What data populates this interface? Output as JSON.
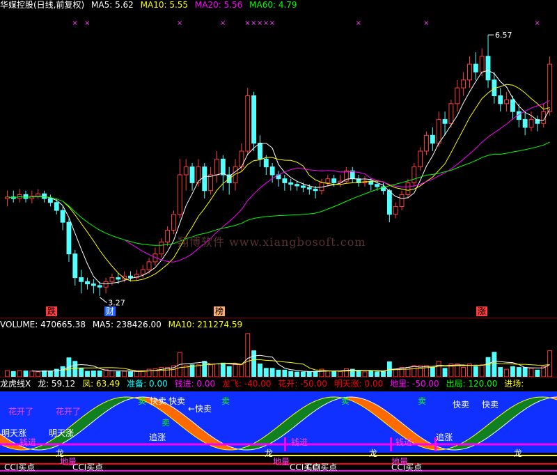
{
  "main_panel": {
    "title": "华媒控股(日线,前复权)",
    "indicators": [
      {
        "label": "MA5: 5.62",
        "color": "#ffffff"
      },
      {
        "label": "MA10: 5.55",
        "color": "#ffff00"
      },
      {
        "label": "MA20: 5.56",
        "color": "#ff00ff"
      },
      {
        "label": "MA60: 4.79",
        "color": "#00ff00"
      }
    ],
    "high_label": "6.57",
    "low_label": "3.27",
    "watermark": "翔博软件 www.xiangbosoft.com",
    "markers": [
      {
        "text": "跌",
        "bg": "#ff3c3c",
        "fg": "#000"
      },
      {
        "text": "财",
        "bg": "#2060ff",
        "fg": "#fff"
      },
      {
        "text": "榜",
        "bg": "#ffb070",
        "fg": "#000"
      },
      {
        "text": "涨",
        "bg": "#ff3c3c",
        "fg": "#000"
      }
    ]
  },
  "volume_panel": {
    "indicators": [
      {
        "label": "VOLUME: 470665.38",
        "color": "#ffffff"
      },
      {
        "label": "MA5: 238426.00",
        "color": "#ffffff"
      },
      {
        "label": "MA10: 211274.59",
        "color": "#ffff00"
      }
    ]
  },
  "signal_panel": {
    "indicators": [
      {
        "label": "龙虎线X",
        "color": "#ffffff"
      },
      {
        "label": "龙: 59.12",
        "color": "#ffffff"
      },
      {
        "label": "凤: 63.49",
        "color": "#ffff00"
      },
      {
        "label": "准备: 0.00",
        "color": "#00ffff"
      },
      {
        "label": "钱进: 0.00",
        "color": "#ff00ff"
      },
      {
        "label": "龙飞: -40.00",
        "color": "#ff0000"
      },
      {
        "label": "花开: -50.00",
        "color": "#ff0000"
      },
      {
        "label": "明天涨: 0.00",
        "color": "#ff0000"
      },
      {
        "label": "地里: -50.00",
        "color": "#ff00ff"
      },
      {
        "label": "出局: 120.00",
        "color": "#00ff00"
      },
      {
        "label": "进场:",
        "color": "#ffff00"
      }
    ],
    "labels": {
      "huakai": "花开了",
      "mingtianzhang": "明天涨",
      "qianjin": "钱进",
      "kuaimai": "快卖",
      "arrow_kuaimai": "←快卖",
      "mai": "卖",
      "zhuizhang": "追涨",
      "cci": "CCI买点",
      "long": "龙",
      "diliang": "地量"
    }
  },
  "chart_data": {
    "type": "candlestick",
    "price_high": 6.57,
    "price_low": 3.27,
    "candles": [
      {
        "o": 4.5,
        "c": 4.52,
        "h": 4.6,
        "l": 4.4
      },
      {
        "o": 4.52,
        "c": 4.5,
        "h": 4.6,
        "l": 4.45
      },
      {
        "o": 4.5,
        "c": 4.55,
        "h": 4.62,
        "l": 4.45
      },
      {
        "o": 4.55,
        "c": 4.5,
        "h": 4.6,
        "l": 4.45
      },
      {
        "o": 4.5,
        "c": 4.53,
        "h": 4.6,
        "l": 4.44
      },
      {
        "o": 4.53,
        "c": 4.56,
        "h": 4.62,
        "l": 4.5
      },
      {
        "o": 4.56,
        "c": 4.5,
        "h": 4.6,
        "l": 4.45
      },
      {
        "o": 4.5,
        "c": 4.45,
        "h": 4.55,
        "l": 4.4
      },
      {
        "o": 4.45,
        "c": 4.35,
        "h": 4.5,
        "l": 4.3
      },
      {
        "o": 4.35,
        "c": 4.2,
        "h": 4.4,
        "l": 4.1
      },
      {
        "o": 4.2,
        "c": 3.8,
        "h": 4.25,
        "l": 3.7
      },
      {
        "o": 3.8,
        "c": 3.5,
        "h": 3.85,
        "l": 3.4
      },
      {
        "o": 3.5,
        "c": 3.45,
        "h": 3.6,
        "l": 3.3
      },
      {
        "o": 3.45,
        "c": 3.42,
        "h": 3.5,
        "l": 3.35
      },
      {
        "o": 3.42,
        "c": 3.4,
        "h": 3.48,
        "l": 3.3
      },
      {
        "o": 3.4,
        "c": 3.38,
        "h": 3.45,
        "l": 3.27
      },
      {
        "o": 3.38,
        "c": 3.45,
        "h": 3.5,
        "l": 3.3
      },
      {
        "o": 3.45,
        "c": 3.5,
        "h": 3.55,
        "l": 3.4
      },
      {
        "o": 3.5,
        "c": 3.48,
        "h": 3.56,
        "l": 3.42
      },
      {
        "o": 3.48,
        "c": 3.52,
        "h": 3.58,
        "l": 3.44
      },
      {
        "o": 3.52,
        "c": 3.5,
        "h": 3.58,
        "l": 3.45
      },
      {
        "o": 3.5,
        "c": 3.54,
        "h": 3.6,
        "l": 3.46
      },
      {
        "o": 3.54,
        "c": 3.6,
        "h": 3.66,
        "l": 3.5
      },
      {
        "o": 3.6,
        "c": 3.7,
        "h": 3.75,
        "l": 3.55
      },
      {
        "o": 3.7,
        "c": 3.8,
        "h": 3.88,
        "l": 3.65
      },
      {
        "o": 3.8,
        "c": 3.95,
        "h": 4.0,
        "l": 3.75
      },
      {
        "o": 3.95,
        "c": 4.1,
        "h": 4.15,
        "l": 3.9
      },
      {
        "o": 4.1,
        "c": 4.3,
        "h": 4.35,
        "l": 4.05
      },
      {
        "o": 4.3,
        "c": 4.8,
        "h": 5.0,
        "l": 4.25
      },
      {
        "o": 4.8,
        "c": 4.9,
        "h": 5.0,
        "l": 4.6
      },
      {
        "o": 4.9,
        "c": 4.7,
        "h": 4.95,
        "l": 4.6
      },
      {
        "o": 4.7,
        "c": 4.9,
        "h": 5.0,
        "l": 4.65
      },
      {
        "o": 4.9,
        "c": 4.6,
        "h": 4.95,
        "l": 4.5
      },
      {
        "o": 4.6,
        "c": 4.8,
        "h": 4.9,
        "l": 4.55
      },
      {
        "o": 4.8,
        "c": 5.0,
        "h": 5.1,
        "l": 4.7
      },
      {
        "o": 5.0,
        "c": 4.8,
        "h": 5.05,
        "l": 4.6
      },
      {
        "o": 4.8,
        "c": 4.7,
        "h": 4.9,
        "l": 4.55
      },
      {
        "o": 4.7,
        "c": 4.9,
        "h": 5.0,
        "l": 4.6
      },
      {
        "o": 4.9,
        "c": 5.1,
        "h": 5.2,
        "l": 4.85
      },
      {
        "o": 5.1,
        "c": 5.8,
        "h": 5.9,
        "l": 5.05
      },
      {
        "o": 5.8,
        "c": 5.2,
        "h": 5.85,
        "l": 5.1
      },
      {
        "o": 5.2,
        "c": 5.0,
        "h": 5.3,
        "l": 4.9
      },
      {
        "o": 5.0,
        "c": 4.9,
        "h": 5.05,
        "l": 4.8
      },
      {
        "o": 4.9,
        "c": 4.8,
        "h": 4.95,
        "l": 4.7
      },
      {
        "o": 4.8,
        "c": 4.75,
        "h": 4.85,
        "l": 4.65
      },
      {
        "o": 4.75,
        "c": 4.7,
        "h": 4.8,
        "l": 4.6
      },
      {
        "o": 4.7,
        "c": 4.68,
        "h": 4.75,
        "l": 4.6
      },
      {
        "o": 4.68,
        "c": 4.66,
        "h": 4.72,
        "l": 4.6
      },
      {
        "o": 4.66,
        "c": 4.64,
        "h": 4.7,
        "l": 4.58
      },
      {
        "o": 4.64,
        "c": 4.62,
        "h": 4.68,
        "l": 4.55
      },
      {
        "o": 4.62,
        "c": 4.6,
        "h": 4.66,
        "l": 4.5
      },
      {
        "o": 4.6,
        "c": 4.7,
        "h": 4.75,
        "l": 4.55
      },
      {
        "o": 4.7,
        "c": 4.75,
        "h": 4.8,
        "l": 4.65
      },
      {
        "o": 4.75,
        "c": 4.7,
        "h": 4.8,
        "l": 4.65
      },
      {
        "o": 4.7,
        "c": 4.72,
        "h": 4.8,
        "l": 4.65
      },
      {
        "o": 4.72,
        "c": 4.85,
        "h": 4.9,
        "l": 4.7
      },
      {
        "o": 4.85,
        "c": 4.75,
        "h": 4.9,
        "l": 4.7
      },
      {
        "o": 4.75,
        "c": 4.7,
        "h": 4.8,
        "l": 4.65
      },
      {
        "o": 4.7,
        "c": 4.72,
        "h": 4.78,
        "l": 4.65
      },
      {
        "o": 4.72,
        "c": 4.68,
        "h": 4.76,
        "l": 4.6
      },
      {
        "o": 4.68,
        "c": 4.65,
        "h": 4.72,
        "l": 4.6
      },
      {
        "o": 4.65,
        "c": 4.6,
        "h": 4.7,
        "l": 4.55
      },
      {
        "o": 4.6,
        "c": 4.3,
        "h": 4.62,
        "l": 4.2
      },
      {
        "o": 4.3,
        "c": 4.4,
        "h": 4.45,
        "l": 4.25
      },
      {
        "o": 4.4,
        "c": 4.55,
        "h": 4.6,
        "l": 4.35
      },
      {
        "o": 4.55,
        "c": 4.7,
        "h": 4.75,
        "l": 4.5
      },
      {
        "o": 4.7,
        "c": 4.9,
        "h": 4.95,
        "l": 4.65
      },
      {
        "o": 4.9,
        "c": 5.1,
        "h": 5.15,
        "l": 4.85
      },
      {
        "o": 5.1,
        "c": 5.3,
        "h": 5.35,
        "l": 5.05
      },
      {
        "o": 5.3,
        "c": 5.2,
        "h": 5.4,
        "l": 5.1
      },
      {
        "o": 5.2,
        "c": 5.5,
        "h": 5.6,
        "l": 5.15
      },
      {
        "o": 5.5,
        "c": 5.45,
        "h": 5.6,
        "l": 5.3
      },
      {
        "o": 5.45,
        "c": 5.7,
        "h": 5.75,
        "l": 5.4
      },
      {
        "o": 5.7,
        "c": 5.9,
        "h": 6.0,
        "l": 5.6
      },
      {
        "o": 5.9,
        "c": 6.0,
        "h": 6.1,
        "l": 5.8
      },
      {
        "o": 6.0,
        "c": 6.2,
        "h": 6.3,
        "l": 5.9
      },
      {
        "o": 6.2,
        "c": 6.1,
        "h": 6.35,
        "l": 6.0
      },
      {
        "o": 6.1,
        "c": 6.3,
        "h": 6.4,
        "l": 6.05
      },
      {
        "o": 6.3,
        "c": 6.0,
        "h": 6.57,
        "l": 5.9
      },
      {
        "o": 6.0,
        "c": 5.8,
        "h": 6.1,
        "l": 5.7
      },
      {
        "o": 5.8,
        "c": 5.7,
        "h": 5.9,
        "l": 5.6
      },
      {
        "o": 5.7,
        "c": 5.75,
        "h": 5.85,
        "l": 5.6
      },
      {
        "o": 5.75,
        "c": 5.6,
        "h": 5.8,
        "l": 5.5
      },
      {
        "o": 5.6,
        "c": 5.5,
        "h": 5.7,
        "l": 5.4
      },
      {
        "o": 5.5,
        "c": 5.4,
        "h": 5.6,
        "l": 5.3
      },
      {
        "o": 5.4,
        "c": 5.5,
        "h": 5.6,
        "l": 5.35
      },
      {
        "o": 5.5,
        "c": 5.45,
        "h": 5.55,
        "l": 5.35
      },
      {
        "o": 5.45,
        "c": 5.6,
        "h": 5.7,
        "l": 5.4
      },
      {
        "o": 5.6,
        "c": 6.2,
        "h": 6.3,
        "l": 5.55
      }
    ]
  }
}
